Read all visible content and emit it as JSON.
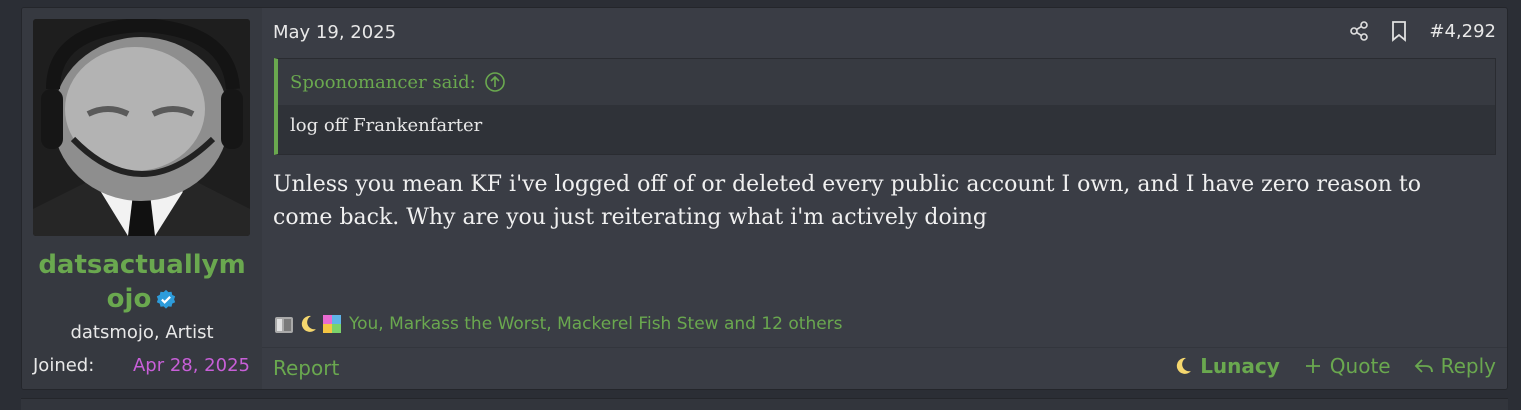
{
  "user": {
    "username": "datsactuallymojo",
    "title": "datsmojo, Artist",
    "joined_label": "Joined:",
    "joined_date": "Apr 28, 2025"
  },
  "post": {
    "date": "May 19, 2025",
    "number": "#4,292",
    "quote": {
      "author_line": "Spoonomancer said:",
      "text": "log off Frankenfarter"
    },
    "message": "Unless you mean KF i've logged off of or deleted every public account I own, and I have zero reason to come back. Why are you just reiterating what i'm actively doing",
    "reactions": {
      "icons": [
        "dumpster-icon",
        "moon-icon",
        "puzzle-icon"
      ],
      "text": "You, Markass the Worst, Mackerel Fish Stew and 12 others"
    }
  },
  "footer": {
    "report": "Report",
    "lunacy": "Lunacy",
    "quote": "Quote",
    "reply": "Reply"
  },
  "colors": {
    "accent": "#6aa84f",
    "joined_date": "#c85fd8",
    "verified": "#2d9cdb"
  }
}
